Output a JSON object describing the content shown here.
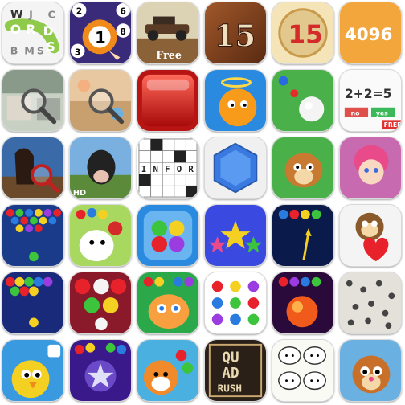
{
  "apps": {
    "word_search": {
      "letters": [
        "W",
        "J",
        "C",
        "O",
        "R",
        "D",
        "S",
        "B",
        "M",
        "S"
      ]
    },
    "bingo_pool": {
      "balls": [
        "2",
        "6",
        "8",
        "1",
        "3"
      ]
    },
    "hill_climb": {
      "label": "Free"
    },
    "fifteen_wood": {
      "label": "15"
    },
    "fifteen_red": {
      "label": "15"
    },
    "game_4096": {
      "label": "4096"
    },
    "math_quiz": {
      "equation": "2+2=5",
      "no_label": "no",
      "yes_label": "yes",
      "badge": "FREE"
    },
    "hidden_objects_hd": {
      "badge": "HD"
    },
    "crossword": {
      "letters": [
        "I",
        "N",
        "F",
        "O",
        "R"
      ]
    },
    "quad_rush": {
      "line1": "QU",
      "line2": "AD",
      "line3": "RUSH"
    }
  },
  "colors": {
    "orange_4096": "#f2a63b",
    "red_15": "#d42a2a",
    "ball_red": "#e8222a",
    "ball_blue": "#2a7be0",
    "ball_green": "#3cc43c",
    "ball_yellow": "#f4d022",
    "ball_purple": "#9a3ce0"
  }
}
